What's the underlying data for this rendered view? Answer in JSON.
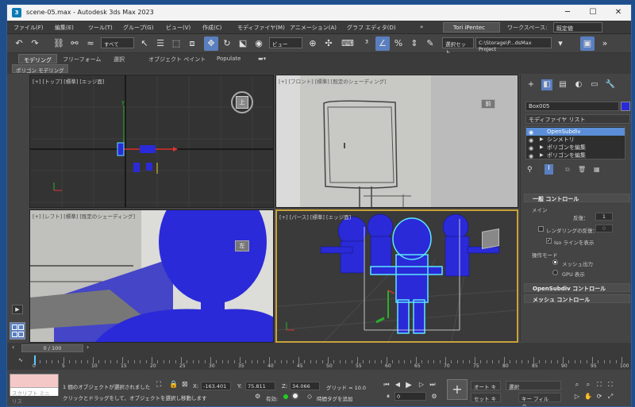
{
  "window": {
    "title": "scene-05.max - Autodesk 3ds Max 2023",
    "app_icon": "3"
  },
  "menu": [
    "ファイル(F)",
    "編集(E)",
    "ツール(T)",
    "グループ(G)",
    "ビュー(V)",
    "作成(C)",
    "モディファイヤ(M)",
    "アニメーション(A)",
    "グラフ エディタ(D)",
    "»"
  ],
  "user": "Tori iPentec",
  "workspace": {
    "label": "ワークスペース:",
    "value": "既定値"
  },
  "toolbar": {
    "selection_filter": "すべて",
    "ref_coord": "ビュー",
    "named_sel": "選択セット",
    "project_path": "C:\\Storage\\P...dsMax Project"
  },
  "ribbon_tabs": [
    "モデリング",
    "フリーフォーム",
    "選択",
    "オブジェクト ペイント",
    "Populate"
  ],
  "ribbon_sub": "ポリゴン モデリング",
  "viewports": {
    "top": "[+] [トップ] [標準] [エッジ面]",
    "front": "[+] [フロント] [標準] [既定のシェーディング]",
    "left": "[+] [レフト] [標準] [既定のシェーディング]",
    "persp": "[+] [パース] [標準] [エッジ面]",
    "cube_top": "上",
    "cube_front": "前",
    "cube_left": "左"
  },
  "command_panel": {
    "object_name": "Box005",
    "modifier_list": "モディファイヤ リスト",
    "stack": [
      "OpenSubdiv",
      "シンメトリ",
      "ポリゴンを編集",
      "ポリゴンを編集"
    ],
    "rollout_general": "一般 コントロール",
    "group_main": "メイン",
    "iterations_label": "反復：",
    "iterations_value": "1",
    "render_iter_label": "レンダリングの反復：",
    "render_iter_value": "0",
    "iso_label": "Iso ラインを表示",
    "op_mode": "操作モード",
    "mesh_out": "メッシュ出力",
    "gpu": "GPU 表示",
    "rollout_osd": "OpenSubdiv コントロール",
    "rollout_mesh": "メッシュ コントロール"
  },
  "timeline": {
    "frame": "0 / 100",
    "ticks": [
      "0",
      "5",
      "10",
      "15",
      "20",
      "25",
      "30",
      "35",
      "40",
      "45",
      "50",
      "55",
      "60",
      "65",
      "70",
      "75",
      "80",
      "85",
      "90",
      "95",
      "100"
    ]
  },
  "status": {
    "mini_label": "スクリプト ミニ リス",
    "selected": "1 個のオブジェクトが選択されました",
    "hint": "クリックとドラッグをして、オブジェクトを選択し移動します",
    "x": "-163.401",
    "y": "75.811",
    "z": "34.066",
    "grid": "グリッド = 10.0",
    "enabled": "有効:",
    "add_tag": "時間タグを追加",
    "auto_key": "オート キー",
    "set_key": "セット キー",
    "sel_dropdown": "選択",
    "key_filter": "キー フィルタ...",
    "frame_value": "0"
  }
}
